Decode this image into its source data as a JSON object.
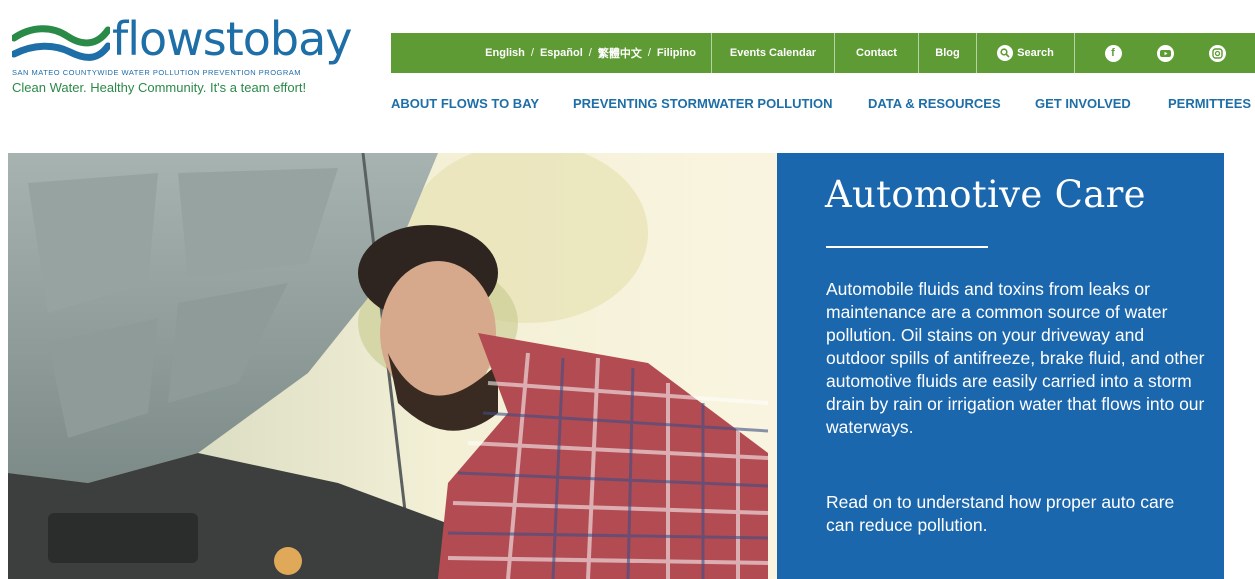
{
  "logo": {
    "wordmark": "flowstobay",
    "subtitle": "SAN MATEO COUNTYWIDE WATER POLLUTION PREVENTION PROGRAM",
    "tagline": "Clean Water. Healthy Community. It's a team effort!"
  },
  "topbar": {
    "languages": [
      "English",
      "Español",
      "繁體中文",
      "Filipino"
    ],
    "separator": "/",
    "events": "Events Calendar",
    "contact": "Contact",
    "blog": "Blog",
    "search": "Search",
    "social": [
      "facebook-icon",
      "youtube-icon",
      "instagram-icon"
    ]
  },
  "nav": {
    "items": [
      "ABOUT FLOWS TO BAY",
      "PREVENTING STORMWATER POLLUTION",
      "DATA & RESOURCES",
      "GET INVOLVED",
      "PERMITTEES"
    ]
  },
  "hero": {
    "title": "Automotive Care",
    "paragraph1": "Automobile fluids and toxins from leaks or maintenance are a common source of water pollution. Oil stains on your driveway and outdoor spills of antifreeze, brake fluid, and other automotive fluids are easily carried into a storm drain by rain or irrigation water that flows into our waterways.",
    "paragraph2": "Read on to understand how proper auto care can reduce pollution."
  },
  "colors": {
    "brand_blue": "#1e6ea7",
    "brand_green": "#5f9b34",
    "panel_blue": "#1b67ad"
  }
}
